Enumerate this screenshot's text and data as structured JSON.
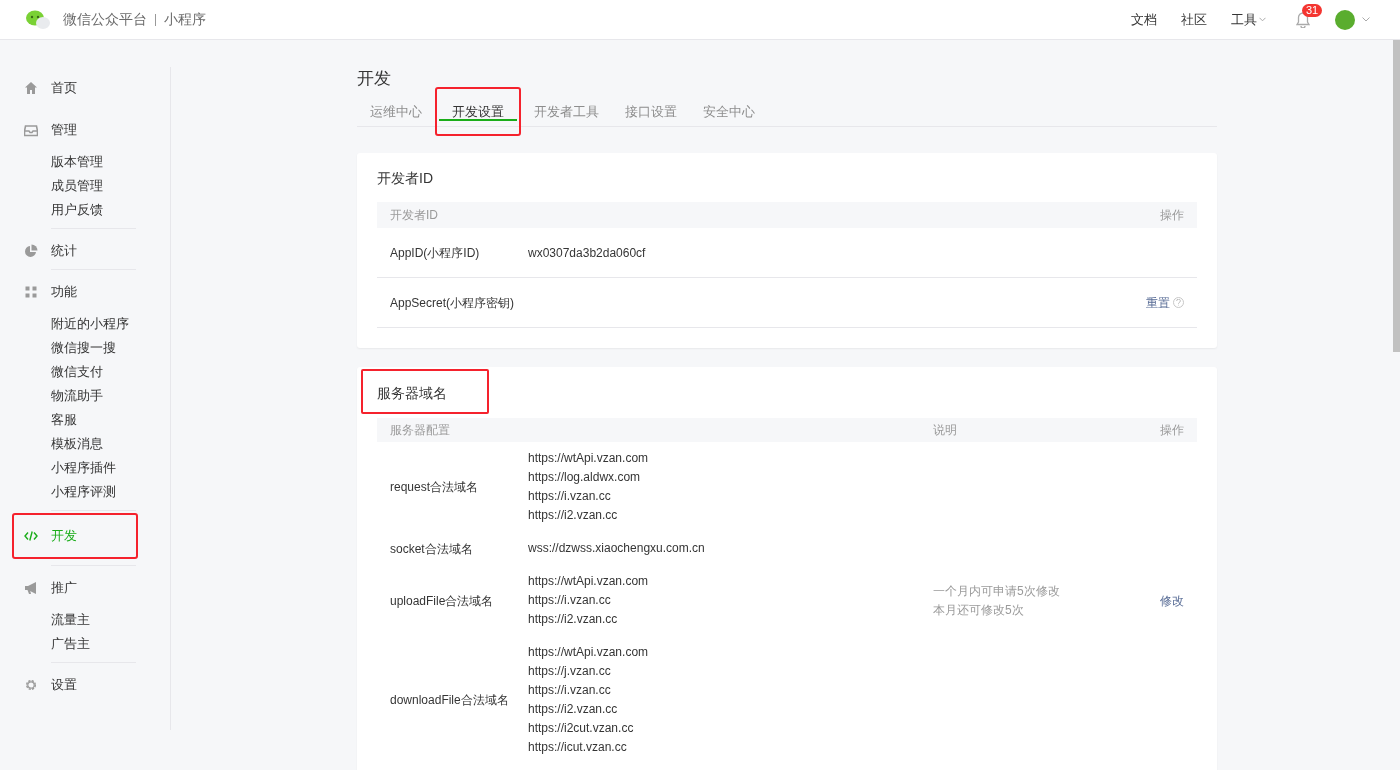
{
  "header": {
    "brand": "微信公众平台",
    "product": "小程序",
    "links": [
      {
        "label": "文档",
        "dropdown": false
      },
      {
        "label": "社区",
        "dropdown": false
      },
      {
        "label": "工具",
        "dropdown": true
      }
    ],
    "notification_count": "31"
  },
  "sidebar": {
    "groups": [
      {
        "label": "首页",
        "selected": false,
        "highlighted": false
      },
      {
        "label": "管理",
        "selected": false,
        "highlighted": false,
        "items": [
          "版本管理",
          "成员管理",
          "用户反馈"
        ]
      },
      {
        "label": "统计",
        "selected": false,
        "highlighted": false
      },
      {
        "label": "功能",
        "selected": false,
        "highlighted": false,
        "items": [
          "附近的小程序",
          "微信搜一搜",
          "微信支付",
          "物流助手",
          "客服",
          "模板消息",
          "小程序插件",
          "小程序评测"
        ]
      },
      {
        "label": "开发",
        "selected": true,
        "highlighted": true
      },
      {
        "label": "推广",
        "selected": false,
        "highlighted": false,
        "items": [
          "流量主",
          "广告主"
        ]
      },
      {
        "label": "设置",
        "selected": false,
        "highlighted": false
      }
    ]
  },
  "page_title": "开发",
  "tabs": [
    {
      "label": "运维中心",
      "selected": false,
      "highlighted": false
    },
    {
      "label": "开发设置",
      "selected": true,
      "highlighted": true
    },
    {
      "label": "开发者工具",
      "selected": false,
      "highlighted": false
    },
    {
      "label": "接口设置",
      "selected": false,
      "highlighted": false
    },
    {
      "label": "安全中心",
      "selected": false,
      "highlighted": false
    }
  ],
  "developer_id": {
    "title": "开发者ID",
    "highlighted": false,
    "columns": [
      "开发者ID",
      "操作"
    ],
    "rows": [
      {
        "label": "AppID(小程序ID)",
        "value": "wx0307da3b2da060cf",
        "action": "",
        "help": false
      },
      {
        "label": "AppSecret(小程序密钥)",
        "value": "",
        "action": "重置",
        "help": true
      }
    ]
  },
  "server_domains": {
    "title": "服务器域名",
    "highlighted": true,
    "columns": [
      "服务器配置",
      "说明",
      "操作"
    ],
    "rows": [
      {
        "label": "request合法域名",
        "values": [
          "https://wtApi.vzan.com",
          "https://log.aldwx.com",
          "https://i.vzan.cc",
          "https://i2.vzan.cc"
        ]
      },
      {
        "label": "socket合法域名",
        "values": [
          "wss://dzwss.xiaochengxu.com.cn"
        ]
      },
      {
        "label": "uploadFile合法域名",
        "values": [
          "https://wtApi.vzan.com",
          "https://i.vzan.cc",
          "https://i2.vzan.cc"
        ]
      },
      {
        "label": "downloadFile合法域名",
        "values": [
          "https://wtApi.vzan.com",
          "https://j.vzan.cc",
          "https://i.vzan.cc",
          "https://i2.vzan.cc",
          "https://i2cut.vzan.cc",
          "https://icut.vzan.cc"
        ]
      }
    ],
    "notes": [
      "一个月内可申请5次修改",
      "本月还可修改5次"
    ],
    "action": "修改"
  }
}
